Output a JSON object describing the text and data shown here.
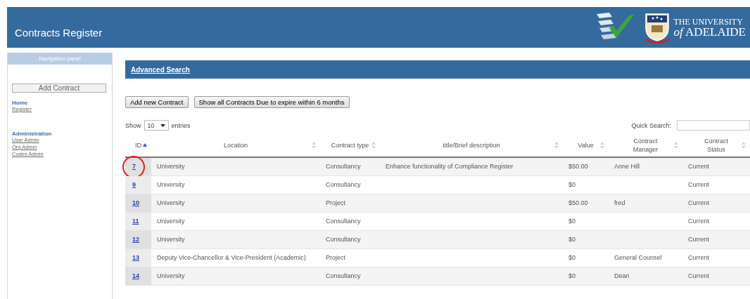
{
  "header": {
    "title": "Contracts Register",
    "logo_lines": [
      "THE UNIVERSITY",
      "*of* ADELAIDE"
    ]
  },
  "nav": {
    "title": "Navigation panel",
    "add_button": "Add Contract",
    "sections": [
      {
        "heading": "Home",
        "links": [
          "Register"
        ]
      },
      {
        "heading": "Administration",
        "links": [
          "User Admin",
          "Org Admin",
          "Codes Admin"
        ]
      }
    ]
  },
  "search_bar": {
    "link": "Advanced Search"
  },
  "buttons": [
    "Add new Contract",
    "Show all Contracts Due to expire within 6 months"
  ],
  "length": {
    "before": "Show",
    "value": "10",
    "after": "entries"
  },
  "quick_search": {
    "label": "Quick Search:"
  },
  "table": {
    "columns": [
      {
        "label": "ID",
        "sorted": true
      },
      {
        "label": "Location",
        "sorted": false
      },
      {
        "label": "Contract type",
        "sorted": false
      },
      {
        "label": "title/Brief description",
        "sorted": false
      },
      {
        "label": "Value",
        "sorted": false
      },
      {
        "label": "Contract Manager",
        "sorted": false
      },
      {
        "label": "Contract Status",
        "sorted": false
      }
    ],
    "rows": [
      {
        "cells": [
          "7",
          "University",
          "Consultancy",
          "Enhance functionality of Compliance Register",
          "$50.00",
          "Anne Hill",
          "Current"
        ],
        "circled": true
      },
      {
        "cells": [
          "9",
          "University",
          "Consultancy",
          "",
          "$0",
          "",
          "Current"
        ],
        "circled": false
      },
      {
        "cells": [
          "10",
          "University",
          "Project",
          "",
          "$50.00",
          "fred",
          "Current"
        ],
        "circled": false
      },
      {
        "cells": [
          "11",
          "University",
          "Consultancy",
          "",
          "$0",
          "",
          "Current"
        ],
        "circled": false
      },
      {
        "cells": [
          "12",
          "University",
          "Consultancy",
          "",
          "$0",
          "",
          "Current"
        ],
        "circled": false
      },
      {
        "cells": [
          "13",
          "Deputy Vice-Chancellor & Vice-President (Academic)",
          "Project",
          "",
          "$0",
          "General Counsel",
          "Current"
        ],
        "circled": false
      },
      {
        "cells": [
          "14",
          "University",
          "Consultancy",
          "",
          "$0",
          "Dean",
          "Current"
        ],
        "circled": false
      }
    ]
  }
}
